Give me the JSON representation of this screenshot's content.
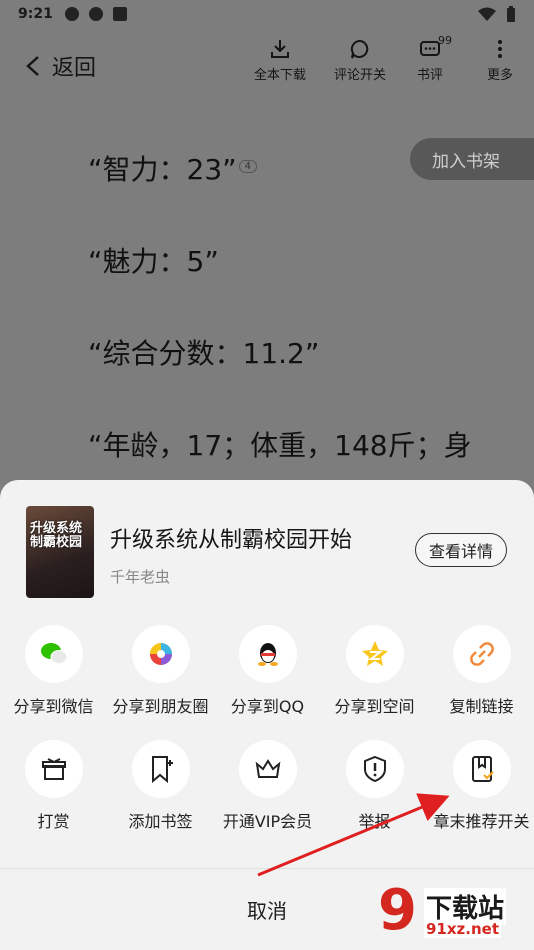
{
  "status": {
    "time": "9:21"
  },
  "topbar": {
    "back_label": "返回",
    "download_label": "全本下载",
    "comments_toggle_label": "评论开关",
    "reviews_label": "书评",
    "reviews_count": "99",
    "more_label": "更多"
  },
  "reader": {
    "lines": [
      "“智力：23”",
      "“魅力：5”",
      "“综合分数：11.2”",
      "“年龄，17；体重，148斤；身"
    ],
    "comment_count": "4",
    "add_shelf_label": "加入书架"
  },
  "book": {
    "title": "升级系统从制霸校园开始",
    "author": "千年老虫",
    "cover_text": "升级系统制霸校园",
    "detail_button": "查看详情"
  },
  "share_row": [
    {
      "label": "分享到微信",
      "icon": "wechat-icon"
    },
    {
      "label": "分享到朋友圈",
      "icon": "moments-icon"
    },
    {
      "label": "分享到QQ",
      "icon": "qq-icon"
    },
    {
      "label": "分享到空间",
      "icon": "qzone-icon"
    },
    {
      "label": "复制链接",
      "icon": "link-icon"
    }
  ],
  "action_row": [
    {
      "label": "打赏",
      "icon": "gift-icon"
    },
    {
      "label": "添加书签",
      "icon": "bookmark-add-icon"
    },
    {
      "label": "开通VIP会员",
      "icon": "crown-icon"
    },
    {
      "label": "举报",
      "icon": "shield-alert-icon"
    },
    {
      "label": "章末推荐开关",
      "icon": "chapter-recommend-icon"
    }
  ],
  "cancel_label": "取消",
  "watermark": {
    "main": "下载站",
    "url": "91xz.net",
    "mark": "9"
  },
  "colors": {
    "accent_red": "#d4271f",
    "wechat_green": "#2dc100",
    "orange": "#f08a3c"
  }
}
